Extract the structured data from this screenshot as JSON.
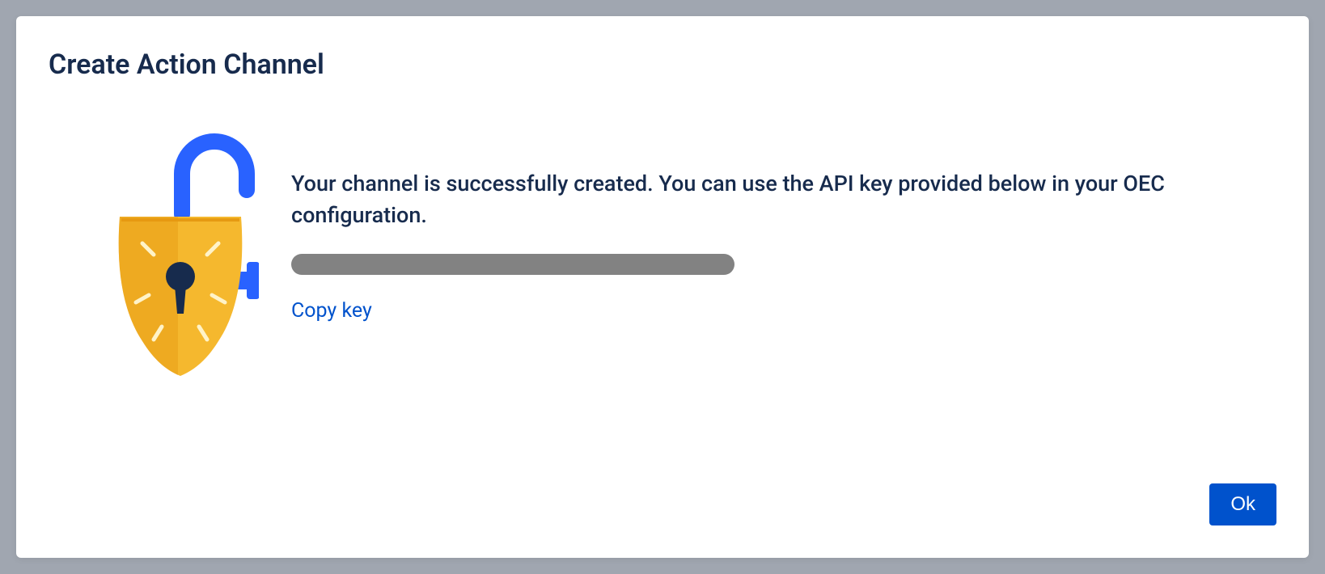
{
  "dialog": {
    "title": "Create Action Channel",
    "message": "Your channel is successfully created. You can use the API key provided below in your OEC configuration.",
    "copy_key_label": "Copy key",
    "ok_label": "Ok"
  },
  "icons": {
    "lock": "lock-icon"
  },
  "colors": {
    "primary": "#0052CC",
    "text": "#172B4D",
    "key_bar": "#828282"
  }
}
